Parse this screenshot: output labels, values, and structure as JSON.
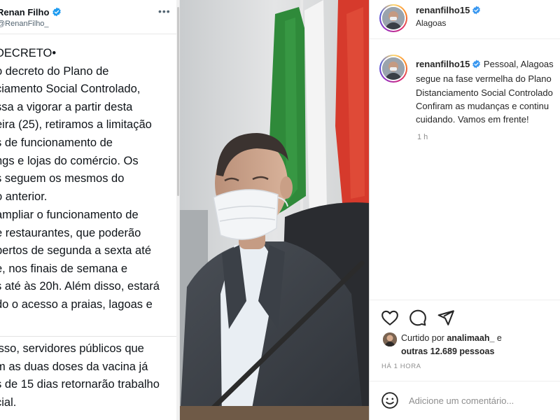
{
  "tweet": {
    "name": "Renan Filho",
    "handle": "@RenanFilho_",
    "more_icon": "more-horizontal-icon",
    "verified_icon": "verified-badge-icon",
    "para1": [
      "DECRETO•",
      "o decreto do Plano de",
      "ciamento Social Controlado,",
      "ssa a vigorar a partir desta",
      "eira (25), retiramos a limitação",
      "s de funcionamento de",
      "ngs e lojas do comércio. Os",
      "s seguem os mesmos do",
      "o anterior."
    ],
    "para2": [
      "ampliar o funcionamento de",
      "e restaurantes, que poderão",
      "bertos de segunda a sexta até",
      "e, nos finais de semana e",
      "s até às 20h. Além disso, estará",
      "do o acesso a praias, lagoas e"
    ],
    "para3": [
      "isso, servidores públicos que",
      "m as duas doses da vacina já",
      "s de 15 dias retornarão trabalho",
      "cial."
    ]
  },
  "photo": {
    "subject_icon": "governor-photo"
  },
  "instagram": {
    "username": "renanfilho15",
    "location": "Alagoas",
    "caption_username": "renanfilho15",
    "caption_lines": [
      "Pessoal, Alagoas",
      "segue na fase vermelha do Plano",
      "Distanciamento Social Controlado",
      "Confiram as mudanças e continu",
      "cuidando. Vamos em frente!"
    ],
    "time_ago": "1 h",
    "liked_by_prefix": "Curtido por",
    "liked_by_user": "analimaah_",
    "liked_by_conj": "e",
    "liked_by_others": "outras 12.689 pessoas",
    "posted_ago": "HÁ 1 HORA",
    "comment_placeholder": "Adicione um comentário...",
    "icons": {
      "like": "heart-icon",
      "comment": "comment-icon",
      "share": "send-icon",
      "emoji": "emoji-icon",
      "verified": "verified-badge-icon"
    }
  },
  "colors": {
    "verified_blue": "#1d9bf0",
    "ig_text": "#262626",
    "ig_muted": "#8e8e8e",
    "flag_green": "#2f8a3a",
    "flag_red": "#d63a2c"
  }
}
